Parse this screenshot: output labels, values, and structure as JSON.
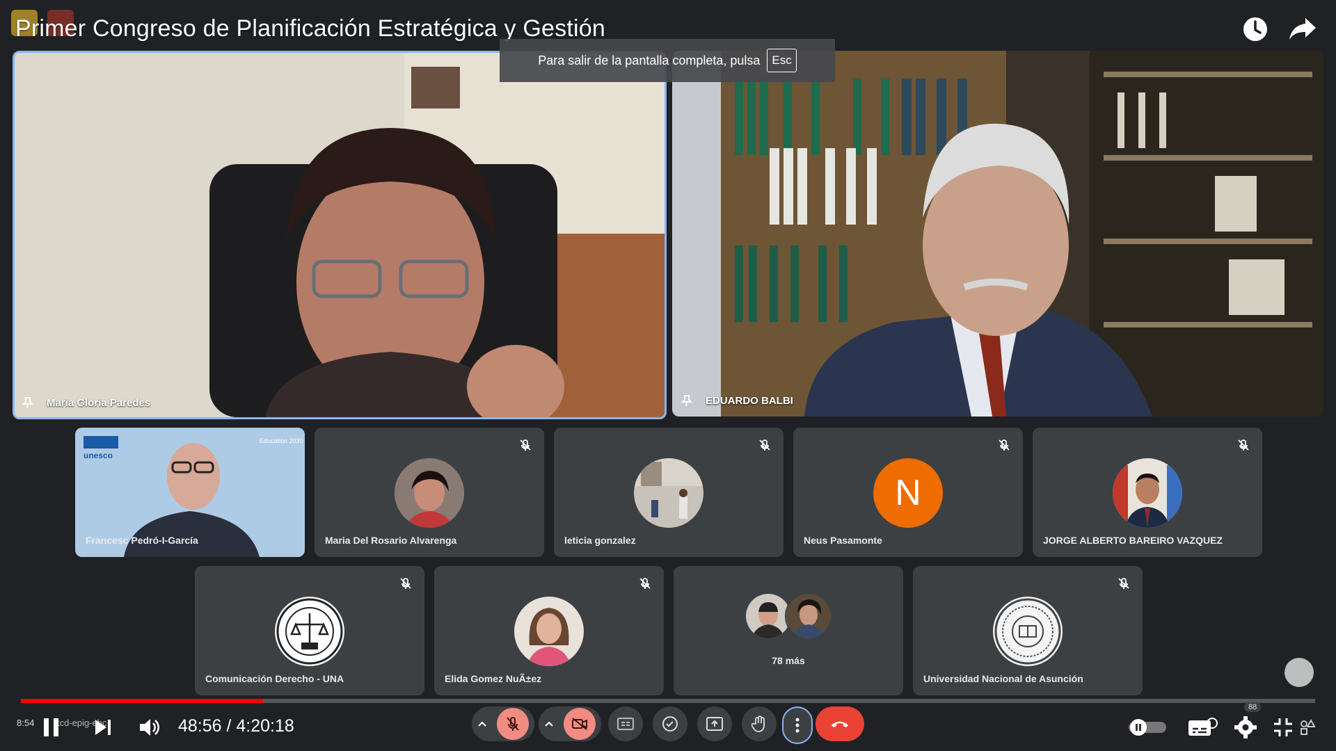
{
  "title": "Primer Congreso de Planificación Estratégica y Gestión",
  "banner": {
    "text": "Para salir de la pantalla completa, pulsa",
    "key": "Esc"
  },
  "main_tiles": [
    {
      "name": "Maria Gloria Paredes"
    },
    {
      "name": "EDUARDO BALBI"
    }
  ],
  "row1": [
    {
      "name": "Francesc Pedró-I-García"
    },
    {
      "name": "Maria Del Rosario Alvarenga"
    },
    {
      "name": "leticia gonzalez"
    },
    {
      "name": "Neus Pasamonte",
      "initial": "N"
    },
    {
      "name": "JORGE ALBERTO BAREIRO VAZQUEZ"
    }
  ],
  "row2": [
    {
      "name": "Comunicación Derecho - UNA"
    },
    {
      "name": "Elida Gomez NuÃ±ez"
    },
    {
      "name": "78 más"
    },
    {
      "name": "Universidad Nacional de Asunción"
    }
  ],
  "unesco_card": {
    "logo": "unesco",
    "tag": "Education 2030"
  },
  "overlay": {
    "left_time": "8:54",
    "meet_code": "tcd-epig-ebc"
  },
  "player": {
    "time": "48:56 / 4:20:18",
    "progress": 0.187,
    "badge": "88"
  },
  "colors": {
    "accent": "#8ab4f8",
    "progress": "#ff0000",
    "end_call": "#ea4335",
    "avatar_n": "#ef6c00"
  }
}
